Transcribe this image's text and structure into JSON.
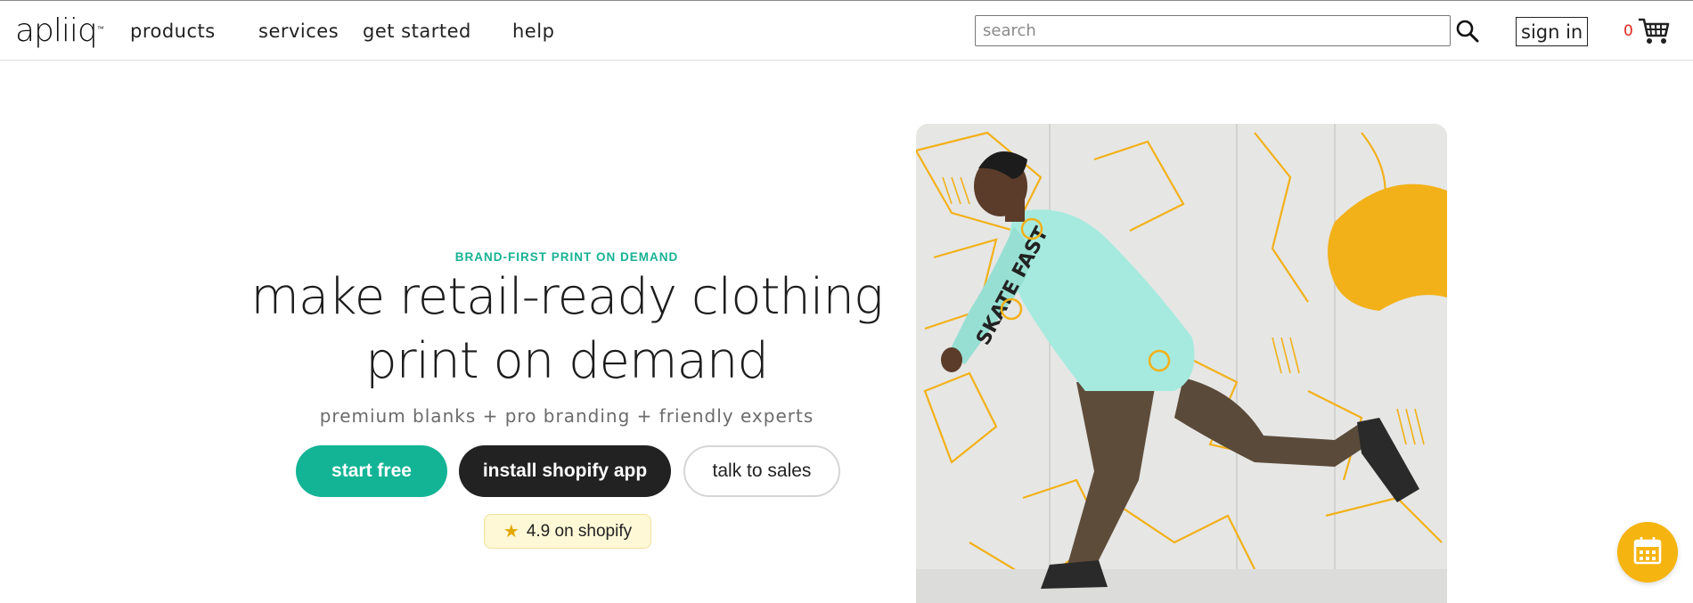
{
  "header": {
    "logo": "apliiq",
    "logo_mark": "™",
    "nav": [
      "products",
      "services",
      "get started",
      "help"
    ],
    "search": {
      "placeholder": "search",
      "value": ""
    },
    "sign_in": "sign in",
    "cart_count": "0"
  },
  "hero": {
    "eyebrow": "BRAND-FIRST PRINT ON DEMAND",
    "headline_line1": "make retail-ready clothing",
    "headline_line2": "print on demand",
    "subline": "premium blanks + pro branding + friendly experts",
    "buttons": {
      "start": "start free",
      "shopify": "install shopify app",
      "sales": "talk to sales"
    },
    "rating": "4.9 on shopify",
    "image_graphic_text": "SKATE FAST"
  },
  "colors": {
    "accent": "#13b495",
    "dark_button": "#222222",
    "rating_bg": "#fff8d6",
    "star": "#e0a800",
    "cart_count": "#e0261f",
    "fab": "#f5b40f",
    "sweater": "#a6eadf",
    "mural_yellow": "#f2b119"
  },
  "icons": {
    "search": "search-icon",
    "cart": "cart-icon",
    "rating": "star-icon",
    "fab": "calendar-icon"
  }
}
